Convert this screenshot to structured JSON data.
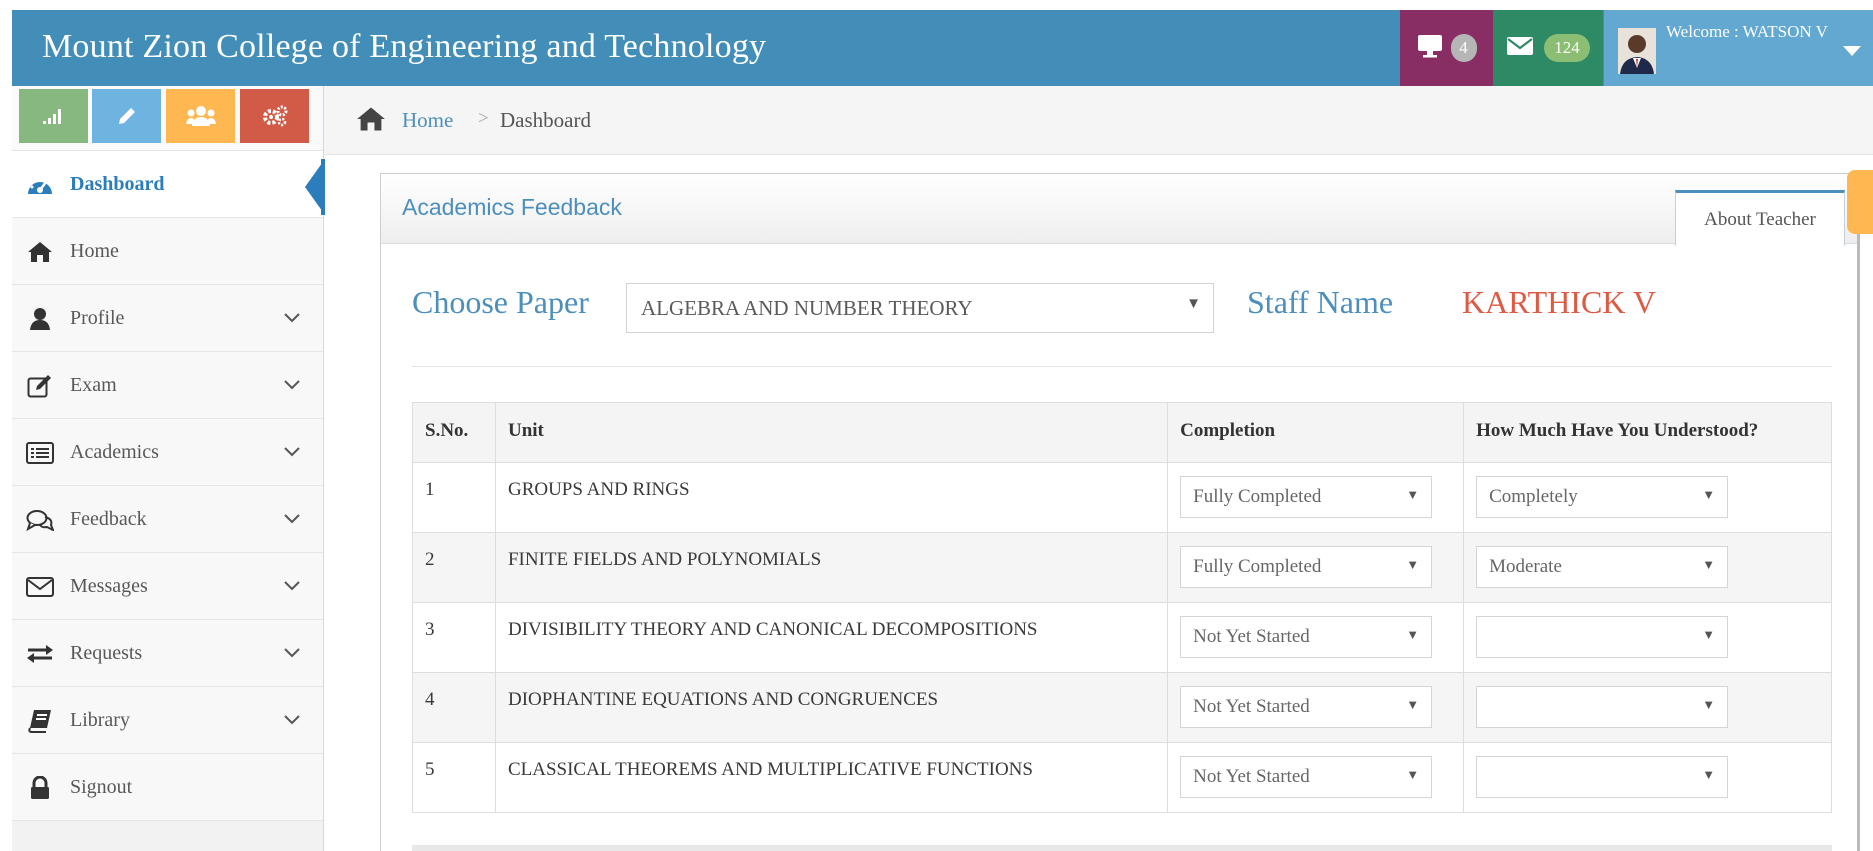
{
  "header": {
    "title": "Mount Zion College of Engineering and Technology",
    "desktop_count": "4",
    "mail_count": "124",
    "welcome": "Welcome : WATSON V"
  },
  "sidebar": {
    "items": [
      {
        "label": "Dashboard",
        "icon": "dashboard-icon"
      },
      {
        "label": "Home",
        "icon": "home-icon"
      },
      {
        "label": "Profile",
        "icon": "user-icon"
      },
      {
        "label": "Exam",
        "icon": "edit-icon"
      },
      {
        "label": "Academics",
        "icon": "list-icon"
      },
      {
        "label": "Feedback",
        "icon": "comments-icon"
      },
      {
        "label": "Messages",
        "icon": "envelope-icon"
      },
      {
        "label": "Requests",
        "icon": "exchange-icon"
      },
      {
        "label": "Library",
        "icon": "book-icon"
      },
      {
        "label": "Signout",
        "icon": "lock-icon"
      }
    ]
  },
  "breadcrumb": {
    "home": "Home",
    "separator": ">",
    "current": "Dashboard"
  },
  "widget": {
    "title": "Academics Feedback",
    "tab": "About Teacher"
  },
  "form": {
    "choose_label": "Choose Paper",
    "paper_value": "ALGEBRA AND NUMBER THEORY",
    "staff_label": "Staff Name",
    "staff_value": "KARTHICK V"
  },
  "table": {
    "headers": [
      "S.No.",
      "Unit",
      "Completion",
      "How Much Have You Understood?"
    ],
    "rows": [
      {
        "sn": "1",
        "unit": "GROUPS AND RINGS",
        "completion": "Fully Completed",
        "understood": "Completely"
      },
      {
        "sn": "2",
        "unit": "FINITE FIELDS AND POLYNOMIALS",
        "completion": "Fully Completed",
        "understood": "Moderate"
      },
      {
        "sn": "3",
        "unit": "DIVISIBILITY THEORY AND CANONICAL DECOMPOSITIONS",
        "completion": "Not Yet Started",
        "understood": ""
      },
      {
        "sn": "4",
        "unit": "DIOPHANTINE EQUATIONS AND CONGRUENCES",
        "completion": "Not Yet Started",
        "understood": ""
      },
      {
        "sn": "5",
        "unit": "CLASSICAL THEOREMS AND MULTIPLICATIVE FUNCTIONS",
        "completion": "Not Yet Started",
        "understood": ""
      }
    ]
  },
  "colors": {
    "header_bg": "#438eb9",
    "accent": "#4c8fbd",
    "staff_name": "#dd5a43",
    "desktop_box": "#892e65",
    "mail_box": "#2e8965"
  }
}
